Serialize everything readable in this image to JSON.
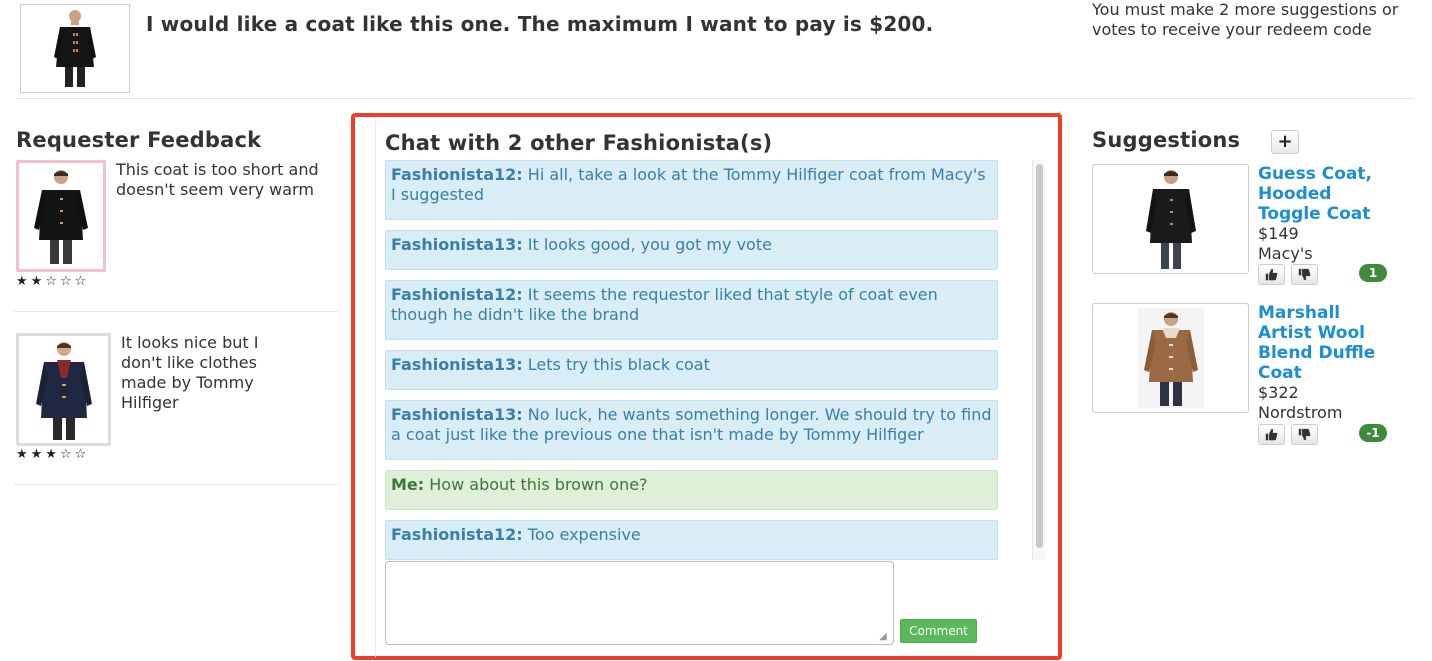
{
  "request": {
    "image": "black-peacoat-photo",
    "text": "I would like a coat like this one. The maximum I want to pay is $200."
  },
  "redeem_note": "You must make 2 more suggestions or votes to receive your redeem code",
  "requester_feedback": {
    "title": "Requester Feedback",
    "items": [
      {
        "comment": "This coat is too short and doesn't seem very warm",
        "rating": 2,
        "stars": "★★☆☆☆",
        "image": "black-duffle-coat-photo"
      },
      {
        "comment": "It looks nice but I don't like clothes made by Tommy Hilfiger",
        "rating": 3,
        "stars": "★★★☆☆",
        "image": "navy-duffle-coat-photo"
      }
    ]
  },
  "chat": {
    "title": "Chat with 2 other Fashionista(s)",
    "messages": [
      {
        "author": "Fashionista12:",
        "text": "Hi all, take a look at the Tommy Hilfiger coat from Macy's I suggested"
      },
      {
        "author": "Fashionista13:",
        "text": "It looks good, you got my vote"
      },
      {
        "author": "Fashionista12:",
        "text": "It seems the requestor liked that style of coat even though he didn't like the brand"
      },
      {
        "author": "Fashionista13:",
        "text": "Lets try this black coat"
      },
      {
        "author": "Fashionista13:",
        "text": "No luck, he wants something longer. We should try to find a coat just like the previous one that isn't made by Tommy Hilfiger"
      },
      {
        "author": "Me:",
        "text": "How about this brown one?"
      },
      {
        "author": "Fashionista12:",
        "text": "Too expensive"
      }
    ],
    "input_value": "",
    "comment_label": "Comment"
  },
  "suggestions": {
    "title": "Suggestions",
    "add_label": "+",
    "items": [
      {
        "name": "Guess Coat, Hooded Toggle Coat",
        "price": "$149",
        "store": "Macy's",
        "votes": "1",
        "image": "guess-toggle-coat-photo"
      },
      {
        "name": "Marshall Artist Wool Blend Duffle Coat",
        "price": "$322",
        "store": "Nordstrom",
        "votes": "-1",
        "image": "brown-duffle-coat-photo"
      }
    ]
  },
  "colors": {
    "accent_link": "#1c8ed3",
    "chat_border": "#f23c2a",
    "msg_bg": "#d9edf7",
    "my_msg_bg": "#dff0d8",
    "comment_button": "#5cb85c",
    "vote_badge": "#3d8b3d"
  }
}
